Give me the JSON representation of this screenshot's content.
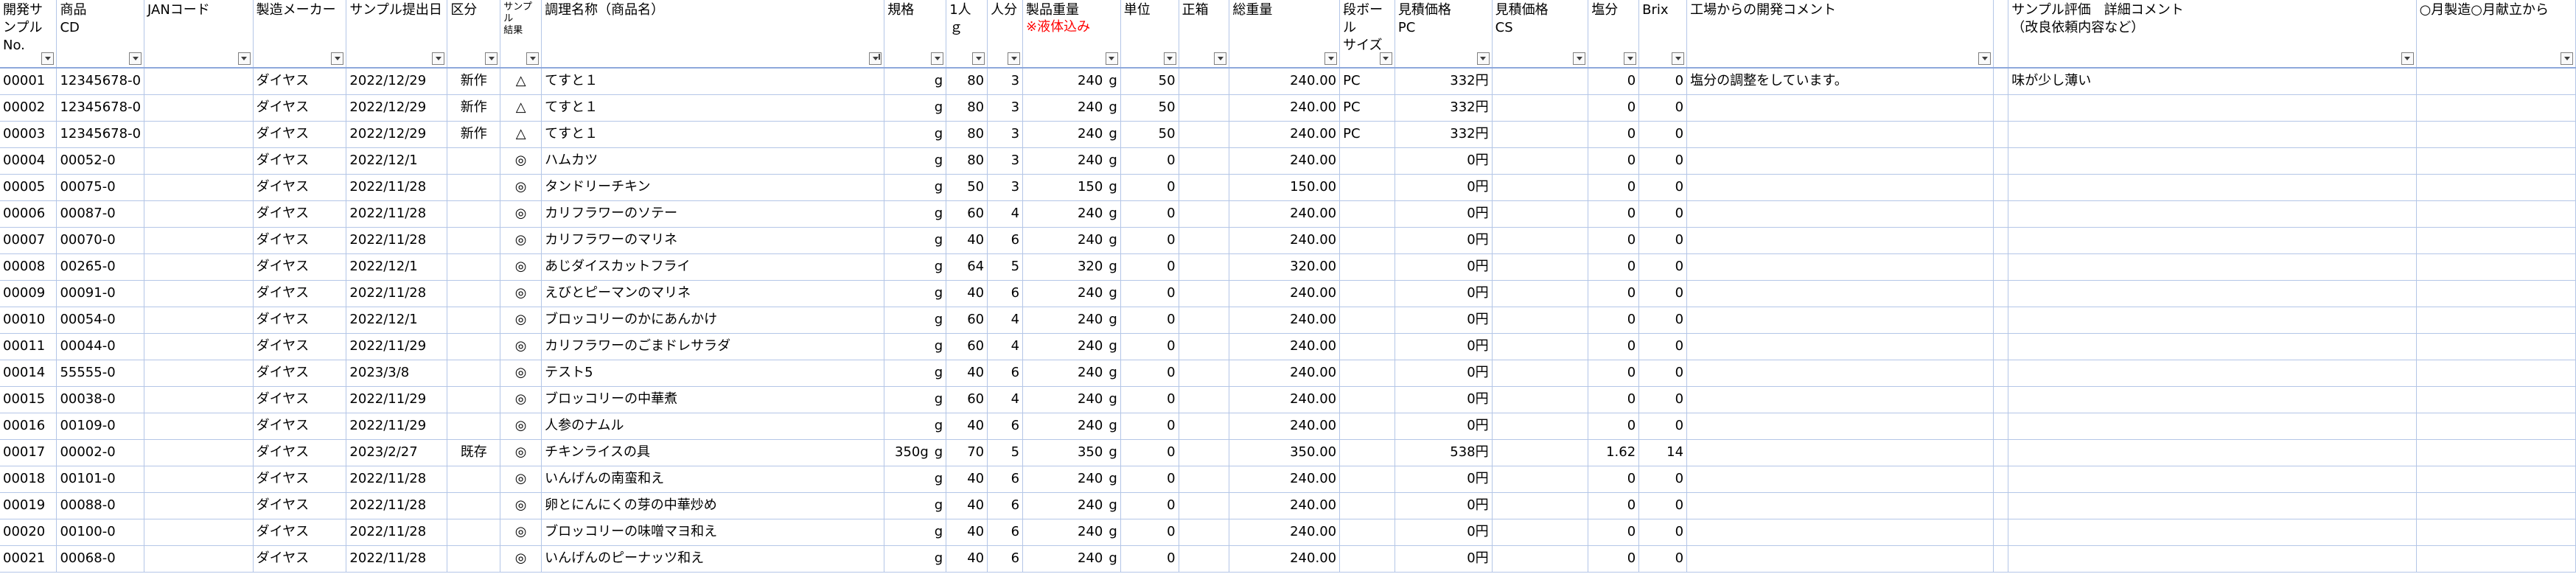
{
  "headers": [
    {
      "key": "dev_no",
      "label": "開発サンプル\nNo."
    },
    {
      "key": "product_cd",
      "label": "商品\nCD"
    },
    {
      "key": "jan",
      "label": "JANコード"
    },
    {
      "key": "maker",
      "label": "製造メーカー"
    },
    {
      "key": "date",
      "label": "サンプル提出日"
    },
    {
      "key": "kubun",
      "label": "区分"
    },
    {
      "key": "result",
      "label": "サンプル\n結果"
    },
    {
      "key": "name",
      "label": "調理名称（商品名）"
    },
    {
      "key": "spec",
      "label": "規格"
    },
    {
      "key": "per_g",
      "label": "1人ｇ"
    },
    {
      "key": "persons",
      "label": "人分"
    },
    {
      "key": "weight",
      "label": "製品重量",
      "note": "※液体込み"
    },
    {
      "key": "unit",
      "label": "単位"
    },
    {
      "key": "box",
      "label": "正箱"
    },
    {
      "key": "total",
      "label": "総重量"
    },
    {
      "key": "carton",
      "label": "段ボール\nサイズ"
    },
    {
      "key": "price_pc",
      "label": "見積価格\nPC"
    },
    {
      "key": "price_cs",
      "label": "見積価格\nCS"
    },
    {
      "key": "salt",
      "label": "塩分"
    },
    {
      "key": "brix",
      "label": "Brix"
    },
    {
      "key": "factory_comment",
      "label": "工場からの開発コメント"
    },
    {
      "key": "eval_comment",
      "label": "サンプル評価　詳細コメント\n（改良依頼内容など）"
    },
    {
      "key": "month",
      "label": "○月製造○月献立から"
    }
  ],
  "rows": [
    {
      "dev_no": "00001",
      "product_cd": "12345678-0",
      "jan": "",
      "maker": "ダイヤス",
      "date": "2022/12/29",
      "kubun": "新作",
      "result": "△",
      "name": "てすと１",
      "spec": "",
      "spec_unit": "g",
      "per_g": "80",
      "persons": "3",
      "weight": "240",
      "weight_unit": "g",
      "unit": "50",
      "box": "",
      "total": "240.00",
      "carton": "PC",
      "price_pc": "332円",
      "price_cs": "",
      "salt": "0",
      "brix": "0",
      "factory_comment": "塩分の調整をしています。",
      "eval_comment": "味が少し薄い",
      "month": ""
    },
    {
      "dev_no": "00002",
      "product_cd": "12345678-0",
      "jan": "",
      "maker": "ダイヤス",
      "date": "2022/12/29",
      "kubun": "新作",
      "result": "△",
      "name": "てすと１",
      "spec": "",
      "spec_unit": "g",
      "per_g": "80",
      "persons": "3",
      "weight": "240",
      "weight_unit": "g",
      "unit": "50",
      "box": "",
      "total": "240.00",
      "carton": "PC",
      "price_pc": "332円",
      "price_cs": "",
      "salt": "0",
      "brix": "0",
      "factory_comment": "",
      "eval_comment": "",
      "month": ""
    },
    {
      "dev_no": "00003",
      "product_cd": "12345678-0",
      "jan": "",
      "maker": "ダイヤス",
      "date": "2022/12/29",
      "kubun": "新作",
      "result": "△",
      "name": "てすと１",
      "spec": "",
      "spec_unit": "g",
      "per_g": "80",
      "persons": "3",
      "weight": "240",
      "weight_unit": "g",
      "unit": "50",
      "box": "",
      "total": "240.00",
      "carton": "PC",
      "price_pc": "332円",
      "price_cs": "",
      "salt": "0",
      "brix": "0",
      "factory_comment": "",
      "eval_comment": "",
      "month": ""
    },
    {
      "dev_no": "00004",
      "product_cd": "00052-0",
      "jan": "",
      "maker": "ダイヤス",
      "date": "2022/12/1",
      "kubun": "",
      "result": "◎",
      "name": "ハムカツ",
      "spec": "",
      "spec_unit": "g",
      "per_g": "80",
      "persons": "3",
      "weight": "240",
      "weight_unit": "g",
      "unit": "0",
      "box": "",
      "total": "240.00",
      "carton": "",
      "price_pc": "0円",
      "price_cs": "",
      "salt": "0",
      "brix": "0",
      "factory_comment": "",
      "eval_comment": "",
      "month": ""
    },
    {
      "dev_no": "00005",
      "product_cd": "00075-0",
      "jan": "",
      "maker": "ダイヤス",
      "date": "2022/11/28",
      "kubun": "",
      "result": "◎",
      "name": "タンドリーチキン",
      "spec": "",
      "spec_unit": "g",
      "per_g": "50",
      "persons": "3",
      "weight": "150",
      "weight_unit": "g",
      "unit": "0",
      "box": "",
      "total": "150.00",
      "carton": "",
      "price_pc": "0円",
      "price_cs": "",
      "salt": "0",
      "brix": "0",
      "factory_comment": "",
      "eval_comment": "",
      "month": ""
    },
    {
      "dev_no": "00006",
      "product_cd": "00087-0",
      "jan": "",
      "maker": "ダイヤス",
      "date": "2022/11/28",
      "kubun": "",
      "result": "◎",
      "name": "カリフラワーのソテー",
      "spec": "",
      "spec_unit": "g",
      "per_g": "60",
      "persons": "4",
      "weight": "240",
      "weight_unit": "g",
      "unit": "0",
      "box": "",
      "total": "240.00",
      "carton": "",
      "price_pc": "0円",
      "price_cs": "",
      "salt": "0",
      "brix": "0",
      "factory_comment": "",
      "eval_comment": "",
      "month": ""
    },
    {
      "dev_no": "00007",
      "product_cd": "00070-0",
      "jan": "",
      "maker": "ダイヤス",
      "date": "2022/11/28",
      "kubun": "",
      "result": "◎",
      "name": "カリフラワーのマリネ",
      "spec": "",
      "spec_unit": "g",
      "per_g": "40",
      "persons": "6",
      "weight": "240",
      "weight_unit": "g",
      "unit": "0",
      "box": "",
      "total": "240.00",
      "carton": "",
      "price_pc": "0円",
      "price_cs": "",
      "salt": "0",
      "brix": "0",
      "factory_comment": "",
      "eval_comment": "",
      "month": ""
    },
    {
      "dev_no": "00008",
      "product_cd": "00265-0",
      "jan": "",
      "maker": "ダイヤス",
      "date": "2022/12/1",
      "kubun": "",
      "result": "◎",
      "name": "あじダイスカットフライ",
      "spec": "",
      "spec_unit": "g",
      "per_g": "64",
      "persons": "5",
      "weight": "320",
      "weight_unit": "g",
      "unit": "0",
      "box": "",
      "total": "320.00",
      "carton": "",
      "price_pc": "0円",
      "price_cs": "",
      "salt": "0",
      "brix": "0",
      "factory_comment": "",
      "eval_comment": "",
      "month": ""
    },
    {
      "dev_no": "00009",
      "product_cd": "00091-0",
      "jan": "",
      "maker": "ダイヤス",
      "date": "2022/11/28",
      "kubun": "",
      "result": "◎",
      "name": "えびとピーマンのマリネ",
      "spec": "",
      "spec_unit": "g",
      "per_g": "40",
      "persons": "6",
      "weight": "240",
      "weight_unit": "g",
      "unit": "0",
      "box": "",
      "total": "240.00",
      "carton": "",
      "price_pc": "0円",
      "price_cs": "",
      "salt": "0",
      "brix": "0",
      "factory_comment": "",
      "eval_comment": "",
      "month": ""
    },
    {
      "dev_no": "00010",
      "product_cd": "00054-0",
      "jan": "",
      "maker": "ダイヤス",
      "date": "2022/12/1",
      "kubun": "",
      "result": "◎",
      "name": "ブロッコリーのかにあんかけ",
      "spec": "",
      "spec_unit": "g",
      "per_g": "60",
      "persons": "4",
      "weight": "240",
      "weight_unit": "g",
      "unit": "0",
      "box": "",
      "total": "240.00",
      "carton": "",
      "price_pc": "0円",
      "price_cs": "",
      "salt": "0",
      "brix": "0",
      "factory_comment": "",
      "eval_comment": "",
      "month": ""
    },
    {
      "dev_no": "00011",
      "product_cd": "00044-0",
      "jan": "",
      "maker": "ダイヤス",
      "date": "2022/11/29",
      "kubun": "",
      "result": "◎",
      "name": "カリフラワーのごまドレサラダ",
      "spec": "",
      "spec_unit": "g",
      "per_g": "60",
      "persons": "4",
      "weight": "240",
      "weight_unit": "g",
      "unit": "0",
      "box": "",
      "total": "240.00",
      "carton": "",
      "price_pc": "0円",
      "price_cs": "",
      "salt": "0",
      "brix": "0",
      "factory_comment": "",
      "eval_comment": "",
      "month": ""
    },
    {
      "dev_no": "00014",
      "product_cd": "55555-0",
      "jan": "",
      "maker": "ダイヤス",
      "date": "2023/3/8",
      "kubun": "",
      "result": "◎",
      "name": "テスト5",
      "spec": "",
      "spec_unit": "g",
      "per_g": "40",
      "persons": "6",
      "weight": "240",
      "weight_unit": "g",
      "unit": "0",
      "box": "",
      "total": "240.00",
      "carton": "",
      "price_pc": "0円",
      "price_cs": "",
      "salt": "0",
      "brix": "0",
      "factory_comment": "",
      "eval_comment": "",
      "month": ""
    },
    {
      "dev_no": "00015",
      "product_cd": "00038-0",
      "jan": "",
      "maker": "ダイヤス",
      "date": "2022/11/29",
      "kubun": "",
      "result": "◎",
      "name": "ブロッコリーの中華煮",
      "spec": "",
      "spec_unit": "g",
      "per_g": "60",
      "persons": "4",
      "weight": "240",
      "weight_unit": "g",
      "unit": "0",
      "box": "",
      "total": "240.00",
      "carton": "",
      "price_pc": "0円",
      "price_cs": "",
      "salt": "0",
      "brix": "0",
      "factory_comment": "",
      "eval_comment": "",
      "month": ""
    },
    {
      "dev_no": "00016",
      "product_cd": "00109-0",
      "jan": "",
      "maker": "ダイヤス",
      "date": "2022/11/29",
      "kubun": "",
      "result": "◎",
      "name": "人参のナムル",
      "spec": "",
      "spec_unit": "g",
      "per_g": "40",
      "persons": "6",
      "weight": "240",
      "weight_unit": "g",
      "unit": "0",
      "box": "",
      "total": "240.00",
      "carton": "",
      "price_pc": "0円",
      "price_cs": "",
      "salt": "0",
      "brix": "0",
      "factory_comment": "",
      "eval_comment": "",
      "month": ""
    },
    {
      "dev_no": "00017",
      "product_cd": "00002-0",
      "jan": "",
      "maker": "ダイヤス",
      "date": "2023/2/27",
      "kubun": "既存",
      "result": "◎",
      "name": "チキンライスの具",
      "spec": "350g",
      "spec_unit": "g",
      "per_g": "70",
      "persons": "5",
      "weight": "350",
      "weight_unit": "g",
      "unit": "0",
      "box": "",
      "total": "350.00",
      "carton": "",
      "price_pc": "538円",
      "price_cs": "",
      "salt": "1.62",
      "brix": "14",
      "factory_comment": "",
      "eval_comment": "",
      "month": ""
    },
    {
      "dev_no": "00018",
      "product_cd": "00101-0",
      "jan": "",
      "maker": "ダイヤス",
      "date": "2022/11/28",
      "kubun": "",
      "result": "◎",
      "name": "いんげんの南蛮和え",
      "spec": "",
      "spec_unit": "g",
      "per_g": "40",
      "persons": "6",
      "weight": "240",
      "weight_unit": "g",
      "unit": "0",
      "box": "",
      "total": "240.00",
      "carton": "",
      "price_pc": "0円",
      "price_cs": "",
      "salt": "0",
      "brix": "0",
      "factory_comment": "",
      "eval_comment": "",
      "month": ""
    },
    {
      "dev_no": "00019",
      "product_cd": "00088-0",
      "jan": "",
      "maker": "ダイヤス",
      "date": "2022/11/28",
      "kubun": "",
      "result": "◎",
      "name": "卵とにんにくの芽の中華炒め",
      "spec": "",
      "spec_unit": "g",
      "per_g": "40",
      "persons": "6",
      "weight": "240",
      "weight_unit": "g",
      "unit": "0",
      "box": "",
      "total": "240.00",
      "carton": "",
      "price_pc": "0円",
      "price_cs": "",
      "salt": "0",
      "brix": "0",
      "factory_comment": "",
      "eval_comment": "",
      "month": ""
    },
    {
      "dev_no": "00020",
      "product_cd": "00100-0",
      "jan": "",
      "maker": "ダイヤス",
      "date": "2022/11/28",
      "kubun": "",
      "result": "◎",
      "name": "ブロッコリーの味噌マヨ和え",
      "spec": "",
      "spec_unit": "g",
      "per_g": "40",
      "persons": "6",
      "weight": "240",
      "weight_unit": "g",
      "unit": "0",
      "box": "",
      "total": "240.00",
      "carton": "",
      "price_pc": "0円",
      "price_cs": "",
      "salt": "0",
      "brix": "0",
      "factory_comment": "",
      "eval_comment": "",
      "month": ""
    },
    {
      "dev_no": "00021",
      "product_cd": "00068-0",
      "jan": "",
      "maker": "ダイヤス",
      "date": "2022/11/28",
      "kubun": "",
      "result": "◎",
      "name": "いんげんのピーナッツ和え",
      "spec": "",
      "spec_unit": "g",
      "per_g": "40",
      "persons": "6",
      "weight": "240",
      "weight_unit": "g",
      "unit": "0",
      "box": "",
      "total": "240.00",
      "carton": "",
      "price_pc": "0円",
      "price_cs": "",
      "salt": "0",
      "brix": "0",
      "factory_comment": "",
      "eval_comment": "",
      "month": ""
    }
  ],
  "colors": {
    "grid": "#b4c6e7",
    "note": "#ff0000"
  }
}
